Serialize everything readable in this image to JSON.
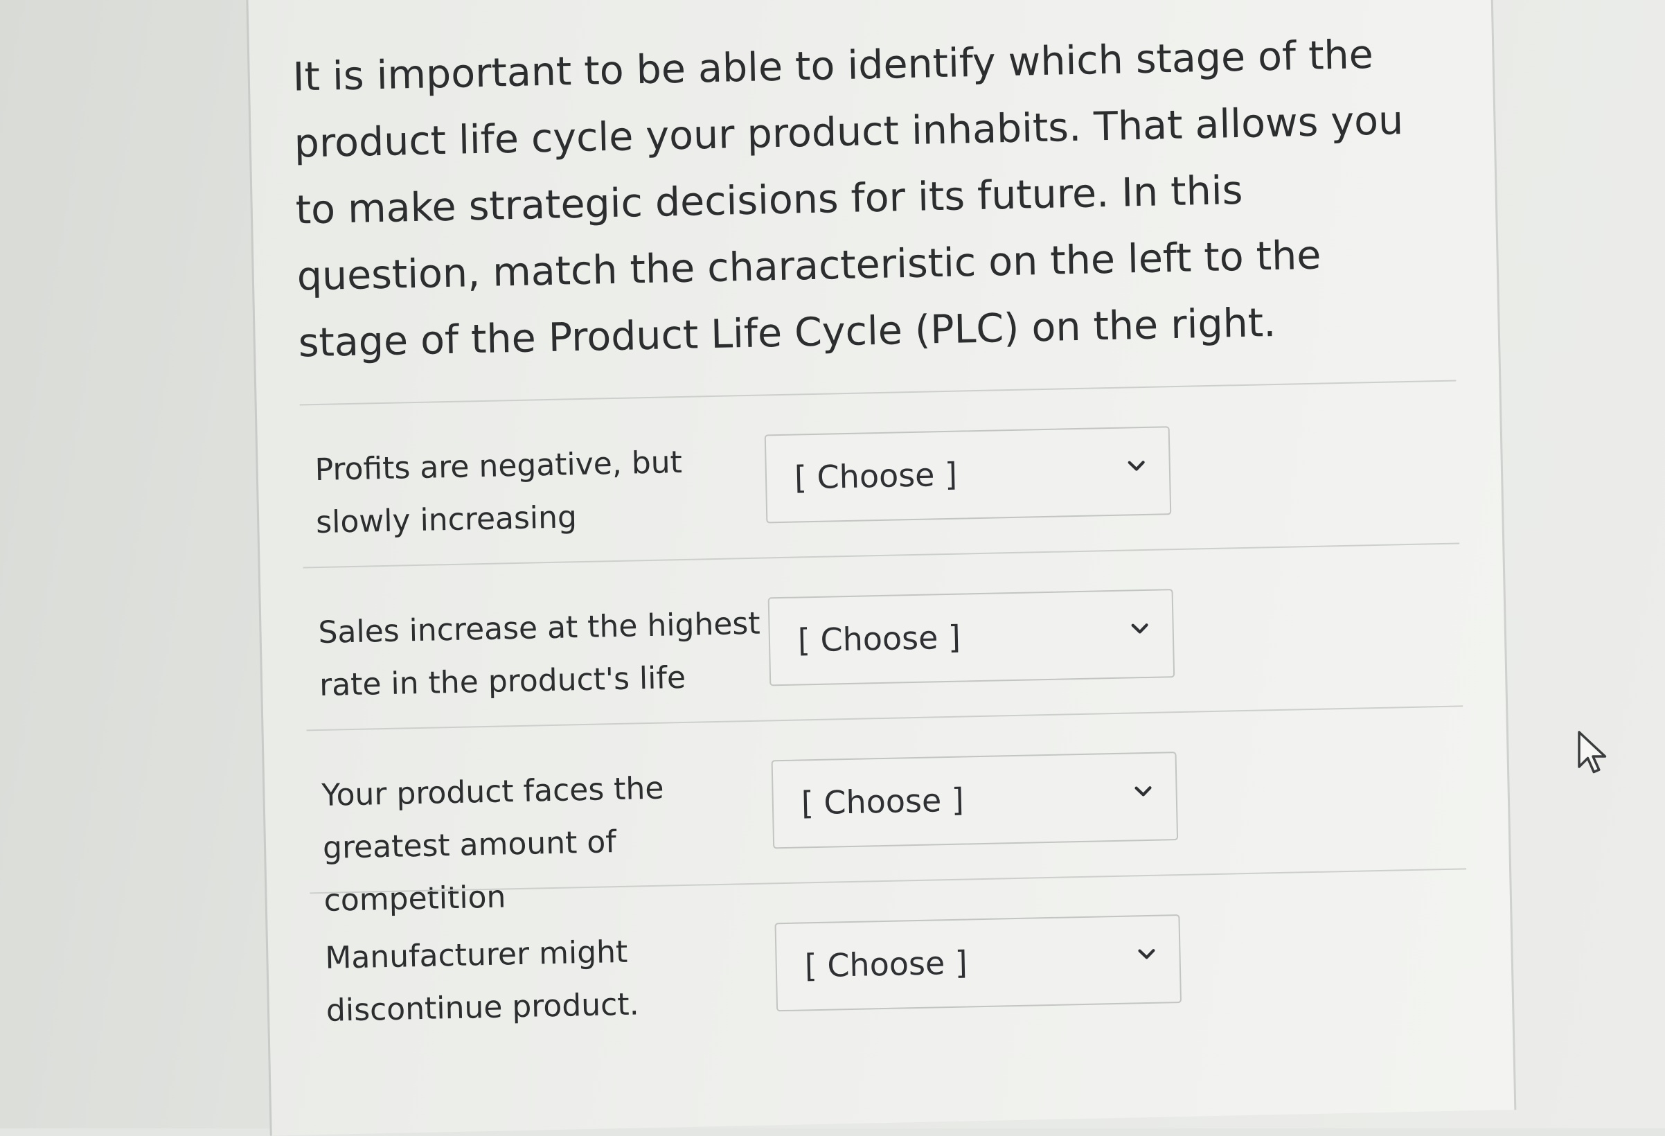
{
  "question": {
    "prompt": "It is important to be able to identify which stage of the product life cycle your product inhabits. That allows you to make strategic decisions for its future. In this question, match the characteristic on the left to the stage of the Product Life Cycle (PLC) on the right."
  },
  "matches": [
    {
      "label": "Profits are negative, but slowly increasing",
      "selected": "[ Choose ]"
    },
    {
      "label": "Sales increase at the highest rate in the product's life",
      "selected": "[ Choose ]"
    },
    {
      "label": "Your product faces the greatest amount of competition",
      "selected": "[ Choose ]"
    },
    {
      "label": "Manufacturer might discontinue product.",
      "selected": "[ Choose ]"
    }
  ],
  "icons": {
    "dropdown": "chevron-down-icon",
    "cursor": "mouse-pointer-icon"
  },
  "colors": {
    "text": "#2b2d2e",
    "select_border": "#c3c5c2",
    "background": "#e4e6e3"
  }
}
